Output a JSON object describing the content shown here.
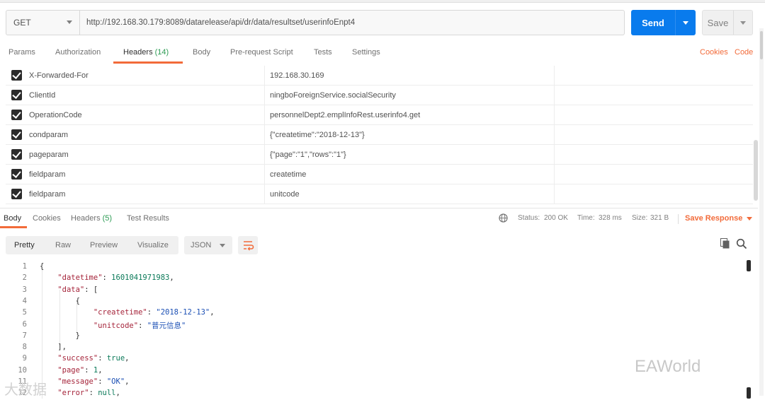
{
  "request": {
    "method": "GET",
    "url": "http://192.168.30.179:8089/datarelease/api/dr/data/resultset/userinfoEnpt4",
    "send_label": "Send",
    "save_label": "Save"
  },
  "request_tabs": {
    "params": "Params",
    "authorization": "Authorization",
    "headers": "Headers",
    "headers_count": "(14)",
    "body": "Body",
    "prerequest": "Pre-request Script",
    "tests": "Tests",
    "settings": "Settings",
    "cookies": "Cookies",
    "code": "Code"
  },
  "headers": [
    {
      "key": "X-Forwarded-For",
      "value": "192.168.30.169",
      "checked": true
    },
    {
      "key": "ClientId",
      "value": "ningboForeignService.socialSecurity",
      "checked": true
    },
    {
      "key": "OperationCode",
      "value": "personnelDept2.emplInfoRest.userinfo4.get",
      "checked": true
    },
    {
      "key": "condparam",
      "value": "{\"createtime\":\"2018-12-13\"}",
      "checked": true
    },
    {
      "key": "pageparam",
      "value": "{\"page\":\"1\",\"rows\":\"1\"}",
      "checked": true
    },
    {
      "key": "fieldparam",
      "value": "createtime",
      "checked": true
    },
    {
      "key": "fieldparam",
      "value": "unitcode",
      "checked": true
    }
  ],
  "response_tabs": {
    "body": "Body",
    "cookies": "Cookies",
    "headers": "Headers",
    "headers_count": "(5)",
    "test_results": "Test Results"
  },
  "response_meta": {
    "status_label": "Status:",
    "status_value": "200 OK",
    "time_label": "Time:",
    "time_value": "328 ms",
    "size_label": "Size:",
    "size_value": "321 B",
    "save_response": "Save Response"
  },
  "view": {
    "pretty": "Pretty",
    "raw": "Raw",
    "preview": "Preview",
    "visualize": "Visualize",
    "format": "JSON"
  },
  "code_lines": [
    {
      "n": "1",
      "parts": [
        [
          "p",
          "{"
        ]
      ]
    },
    {
      "n": "2",
      "parts": [
        [
          "p",
          "    "
        ],
        [
          "k",
          "\"datetime\""
        ],
        [
          "p",
          ": "
        ],
        [
          "n",
          "1601041971983"
        ],
        [
          "p",
          ","
        ]
      ]
    },
    {
      "n": "3",
      "parts": [
        [
          "p",
          "    "
        ],
        [
          "k",
          "\"data\""
        ],
        [
          "p",
          ": ["
        ]
      ]
    },
    {
      "n": "4",
      "parts": [
        [
          "p",
          "        {"
        ]
      ]
    },
    {
      "n": "5",
      "parts": [
        [
          "p",
          "            "
        ],
        [
          "k",
          "\"createtime\""
        ],
        [
          "p",
          ": "
        ],
        [
          "s",
          "\"2018-12-13\""
        ],
        [
          "p",
          ","
        ]
      ]
    },
    {
      "n": "6",
      "parts": [
        [
          "p",
          "            "
        ],
        [
          "k",
          "\"unitcode\""
        ],
        [
          "p",
          ": "
        ],
        [
          "s",
          "\"普元信息\""
        ]
      ]
    },
    {
      "n": "7",
      "parts": [
        [
          "p",
          "        }"
        ]
      ]
    },
    {
      "n": "8",
      "parts": [
        [
          "p",
          "    ],"
        ]
      ]
    },
    {
      "n": "9",
      "parts": [
        [
          "p",
          "    "
        ],
        [
          "k",
          "\"success\""
        ],
        [
          "p",
          ": "
        ],
        [
          "n",
          "true"
        ],
        [
          "p",
          ","
        ]
      ]
    },
    {
      "n": "10",
      "parts": [
        [
          "p",
          "    "
        ],
        [
          "k",
          "\"page\""
        ],
        [
          "p",
          ": "
        ],
        [
          "n",
          "1"
        ],
        [
          "p",
          ","
        ]
      ]
    },
    {
      "n": "11",
      "parts": [
        [
          "p",
          "    "
        ],
        [
          "k",
          "\"message\""
        ],
        [
          "p",
          ": "
        ],
        [
          "s",
          "\"OK\""
        ],
        [
          "p",
          ","
        ]
      ]
    },
    {
      "n": "12",
      "parts": [
        [
          "p",
          "    "
        ],
        [
          "k",
          "\"error\""
        ],
        [
          "p",
          ": "
        ],
        [
          "n",
          "null"
        ],
        [
          "p",
          ","
        ]
      ]
    }
  ],
  "watermarks": {
    "right": "EAWorld",
    "left": "大数据"
  },
  "icons": {
    "globe": "globe-icon",
    "copy": "copy-icon",
    "search": "search-icon",
    "wrap": "wrap-lines-icon"
  }
}
